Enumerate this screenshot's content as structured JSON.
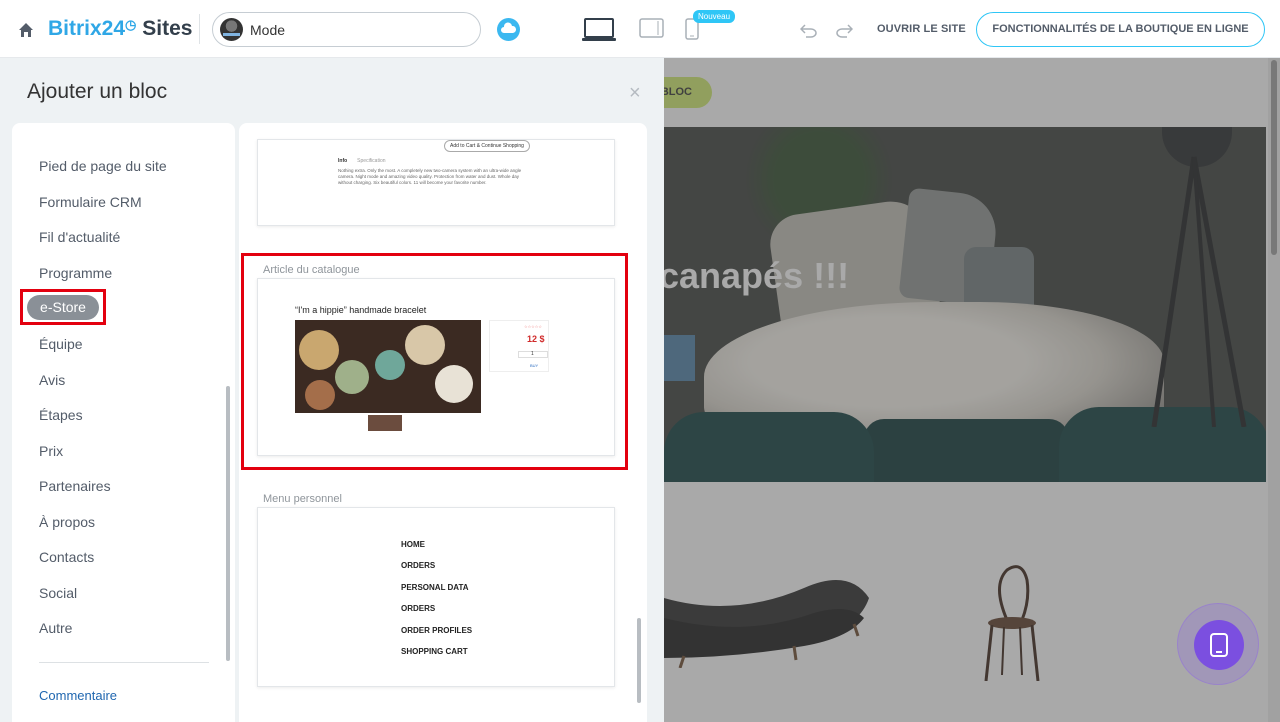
{
  "header": {
    "logo_brand": "Bitrix24",
    "logo_suffix": "Sites",
    "mode_label": "Mode",
    "badge_new": "Nouveau",
    "open_site": "OUVRIR LE SITE",
    "shop_features": "FONCTIONNALITÉS DE LA BOUTIQUE EN LIGNE"
  },
  "panel": {
    "title": "Ajouter un bloc",
    "close": "×",
    "categories": [
      "Pied de page du site",
      "Formulaire CRM",
      "Fil d'actualité",
      "Programme",
      "e-Store",
      "Équipe",
      "Avis",
      "Étapes",
      "Prix",
      "Partenaires",
      "À propos",
      "Contacts",
      "Social",
      "Autre"
    ],
    "active_category": "e-Store",
    "comment_link": "Commentaire"
  },
  "blocks": {
    "card1": {
      "button": "Add to Cart & Continue Shopping",
      "tab_active": "Info",
      "tab_other": "Specification",
      "description": "Nothing extra. Only the most. A completely new two-camera system with an ultra-wide angle camera. Night mode and amazing video quality. Protection from water and dust. Whole day without charging. Six beautiful colors. 11 will become your favorite number."
    },
    "card2": {
      "label": "Article du catalogue",
      "product_title": "“I'm a hippie” handmade bracelet",
      "stars": "☆☆☆☆☆",
      "price": "12 $",
      "qty": "1",
      "buy": "BUY"
    },
    "card3": {
      "label": "Menu personnel",
      "items": [
        "HOME",
        "ORDERS",
        "PERSONAL DATA",
        "ORDERS",
        "ORDER PROFILES",
        "SHOPPING CART"
      ]
    }
  },
  "preview": {
    "add_block": "BLOC",
    "hero_title": "canapés !!!"
  },
  "colors": {
    "accent": "#2fc6f6",
    "logo_blue": "#2fa7e6",
    "highlight": "#e3000f",
    "fab": "#7b4fe0"
  },
  "icons": [
    "home-icon",
    "cloud-icon",
    "desktop-icon",
    "tablet-icon",
    "mobile-icon",
    "undo-icon",
    "redo-icon",
    "close-icon",
    "mobile-preview-icon"
  ]
}
